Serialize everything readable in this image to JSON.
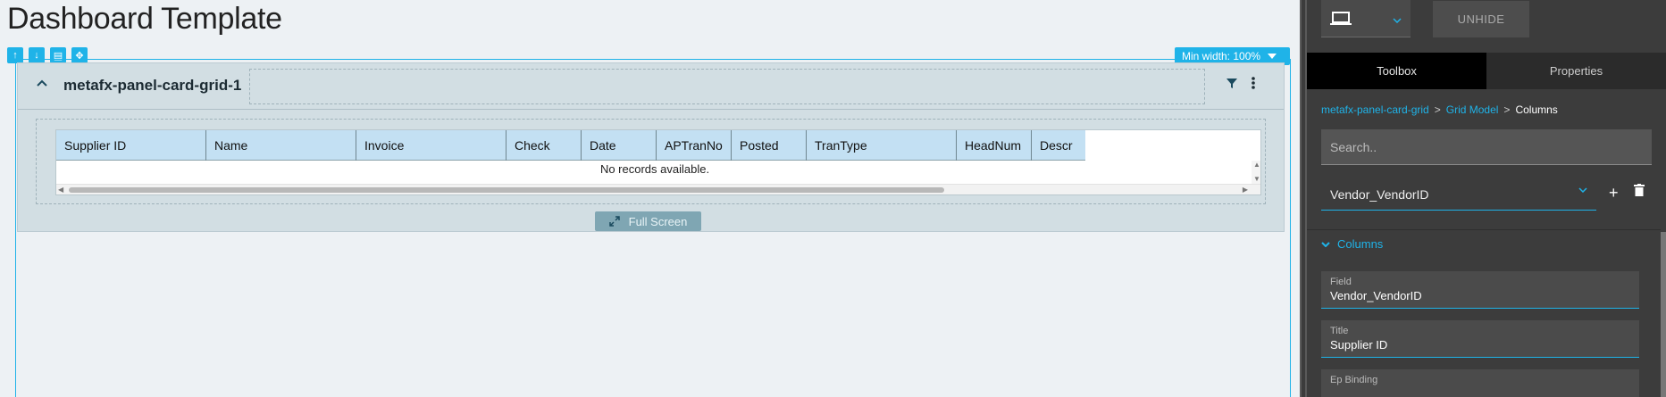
{
  "page_title": "Dashboard Template",
  "canvas_controls": {
    "move_up": "↑",
    "move_down": "↓",
    "copy": "▤",
    "drag": "✥",
    "min_width_label": "Min width: 100%"
  },
  "card": {
    "title": "metafx-panel-card-grid-1",
    "grid": {
      "columns": [
        "Supplier ID",
        "Name",
        "Invoice",
        "Check",
        "Date",
        "APTranNo",
        "Posted",
        "TranType",
        "HeadNum",
        "Descr"
      ],
      "empty_message": "No records available."
    },
    "fullscreen_label": "Full Screen"
  },
  "panel": {
    "unhide_label": "UNHIDE",
    "tabs": [
      {
        "label": "Toolbox",
        "active": true
      },
      {
        "label": "Properties",
        "active": false
      }
    ],
    "breadcrumb": [
      "metafx-panel-card-grid",
      "Grid Model",
      "Columns"
    ],
    "breadcrumb_sep": ">",
    "search_placeholder": "Search..",
    "selected_column": "Vendor_VendorID",
    "add_symbol": "+",
    "section_title": "Columns",
    "fields": [
      {
        "label": "Field",
        "value": "Vendor_VendorID"
      },
      {
        "label": "Title",
        "value": "Supplier ID"
      },
      {
        "label": "Ep Binding",
        "value": ""
      }
    ]
  },
  "colors": {
    "accent": "#1fb3e8",
    "grid_header": "#c3e0f3",
    "card_bg": "#d2dee3",
    "panel_bg": "#3c3c3c"
  }
}
